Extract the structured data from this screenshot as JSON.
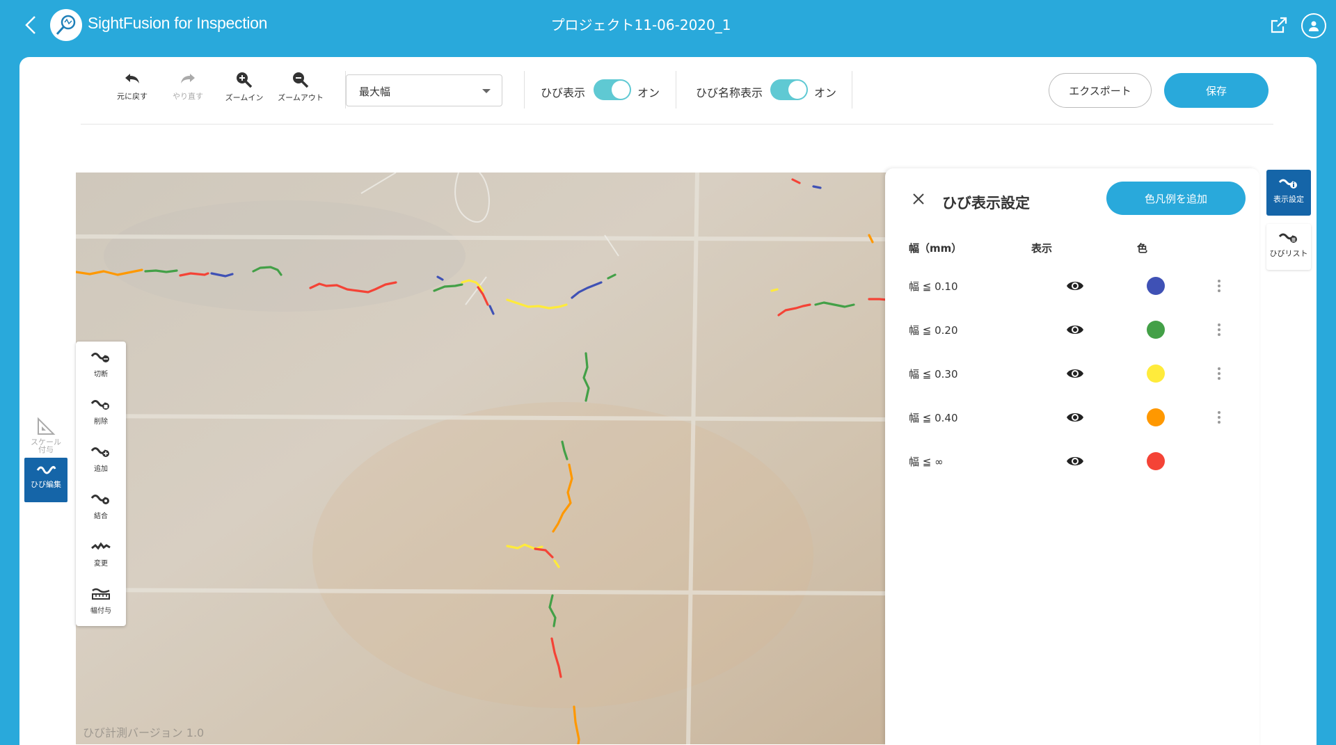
{
  "header": {
    "app_name": "SightFusion for Inspection",
    "project_title": "プロジェクト11-06-2020_1"
  },
  "toolbar": {
    "undo_label": "元に戻す",
    "redo_label": "やり直す",
    "zoom_in_label": "ズームイン",
    "zoom_out_label": "ズームアウト",
    "width_select": "最大幅",
    "crack_display_label": "ひび表示",
    "crack_display_state": "オン",
    "crack_name_display_label": "ひび名称表示",
    "crack_name_display_state": "オン",
    "export_label": "エクスポート",
    "save_label": "保存"
  },
  "edit_tools": [
    {
      "label": "切断",
      "icon": "cut-crack-icon"
    },
    {
      "label": "削除",
      "icon": "delete-crack-icon"
    },
    {
      "label": "追加",
      "icon": "add-crack-icon"
    },
    {
      "label": "結合",
      "icon": "merge-crack-icon"
    },
    {
      "label": "変更",
      "icon": "change-crack-icon"
    },
    {
      "label": "幅付与",
      "icon": "width-assign-icon"
    }
  ],
  "left_tabs": {
    "scale_label": "スケール\n付与",
    "crack_edit_label": "ひび編集"
  },
  "right_tabs": {
    "display_settings_label": "表示設定",
    "crack_list_label": "ひびリスト"
  },
  "watermark": "ひび計測バージョン 1.0",
  "panel": {
    "title": "ひび表示設定",
    "add_legend_label": "色凡例を追加",
    "col_width": "幅（mm）",
    "col_display": "表示",
    "col_color": "色",
    "rows": [
      {
        "width": "幅 ≦ 0.10",
        "color": "#3f51b5"
      },
      {
        "width": "幅 ≦ 0.20",
        "color": "#43a047"
      },
      {
        "width": "幅 ≦ 0.30",
        "color": "#ffeb3b"
      },
      {
        "width": "幅 ≦ 0.40",
        "color": "#ff9800"
      },
      {
        "width": "幅 ≦ ∞",
        "color": "#f44336"
      }
    ]
  }
}
